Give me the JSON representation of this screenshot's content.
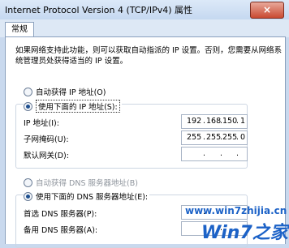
{
  "window": {
    "title": "Internet Protocol Version 4 (TCP/IPv4) 属性",
    "close_glyph": "×"
  },
  "tabs": [
    {
      "label": "常规"
    }
  ],
  "description": "如果网络支持此功能，则可以获取自动指派的 IP 设置。否则，您需要从网络系统管理员处获得适当的 IP 设置。",
  "ip_section": {
    "auto_option": "自动获得 IP 地址(O)",
    "manual_option": "使用下面的 IP 地址(S):",
    "selected": "manual",
    "fields": [
      {
        "label": "IP 地址(I):",
        "octets": [
          "192",
          "168",
          "150",
          "1"
        ]
      },
      {
        "label": "子网掩码(U):",
        "octets": [
          "255",
          "255",
          "255",
          "0"
        ]
      },
      {
        "label": "默认网关(D):",
        "octets": [
          "",
          "",
          "",
          ""
        ]
      }
    ]
  },
  "dns_section": {
    "auto_option": "自动获得 DNS 服务器地址(B)",
    "manual_option": "使用下面的 DNS 服务器地址(E):",
    "selected": "manual",
    "fields": [
      {
        "label": "首选 DNS 服务器(P):"
      },
      {
        "label": "备用 DNS 服务器(A):"
      }
    ]
  },
  "watermark": {
    "url": "www.win7zhijia.cn",
    "logo": "Win7之家"
  },
  "colors": {
    "accent": "#1f4f8e",
    "watermark": "#1c62c7",
    "close_button": "#c94a31"
  }
}
